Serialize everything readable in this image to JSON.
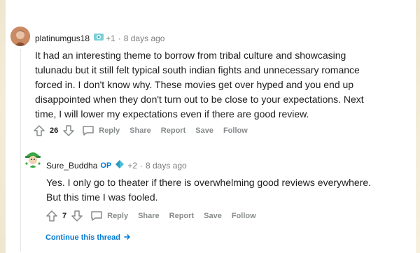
{
  "comments": [
    {
      "username": "platinumgus18",
      "award_count": "+1",
      "separator": "·",
      "time": "8 days ago",
      "body": [
        "It had an interesting theme to borrow from tribal culture and showcasing",
        "tulunadu but it still felt typical south indian fights and unnecessary romance",
        "forced in. I don't know why. These movies get over hyped and you end up",
        "disappointed when they don't turn out to be close to your expectations. Next",
        "time, I will lower my expectations even if there are good review."
      ],
      "votes": "26",
      "actions": {
        "reply": "Reply",
        "share": "Share",
        "report": "Report",
        "save": "Save",
        "follow": "Follow"
      }
    },
    {
      "username": "Sure_Buddha",
      "op_badge": "OP",
      "award_count": "+2",
      "separator": "·",
      "time": "8 days ago",
      "body": [
        "Yes. I only go to theater if there is overwhelming good reviews everywhere.",
        "But this time I was fooled."
      ],
      "votes": "7",
      "actions": {
        "reply": "Reply",
        "share": "Share",
        "report": "Report",
        "save": "Save",
        "follow": "Follow"
      }
    }
  ],
  "continue_thread": "Continue this thread",
  "colors": {
    "link": "#0079d3",
    "meta": "#7c7c7c",
    "action": "#878a8c"
  },
  "icons": [
    "upvote-icon",
    "downvote-icon",
    "comment-icon",
    "award-icon",
    "arrow-right-icon"
  ]
}
